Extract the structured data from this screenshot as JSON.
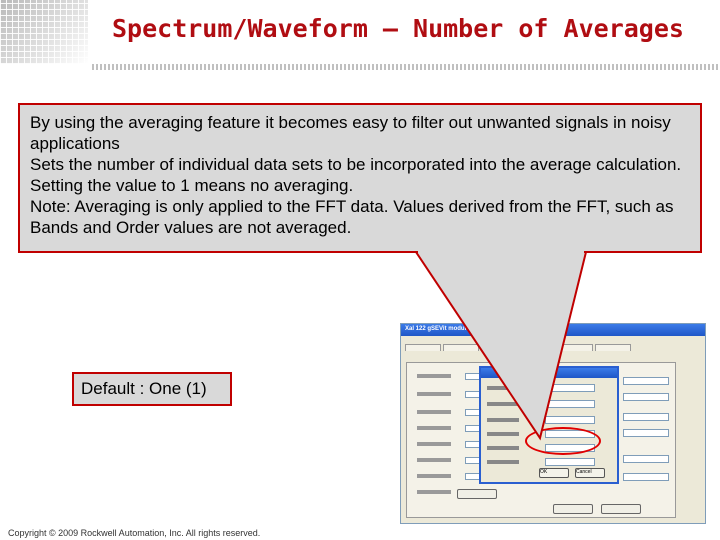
{
  "slide": {
    "title": "Spectrum/Waveform – Number of Averages",
    "callout_lines": [
      "By using the averaging feature it becomes easy to filter out unwanted signals in noisy applications",
      "Sets the number of individual data sets to be incorporated into the average calculation.  Setting the value to 1 means no averaging.",
      "Note: Averaging is only applied to the FFT data. Values derived from the FFT, such as Bands and Order values are not averaged."
    ],
    "default_label": "Default : One (1)",
    "footer": "Copyright © 2009 Rockwell Automation, Inc. All rights reserved."
  },
  "colors": {
    "title_red": "#b00d12",
    "callout_border": "#c00000",
    "callout_fill": "#d9d9d9"
  },
  "screenshot": {
    "window_title": "Xal 122 gSEVit module",
    "dialog_title": "Spe...",
    "dialog_buttons": [
      "OK",
      "Cancel"
    ]
  }
}
